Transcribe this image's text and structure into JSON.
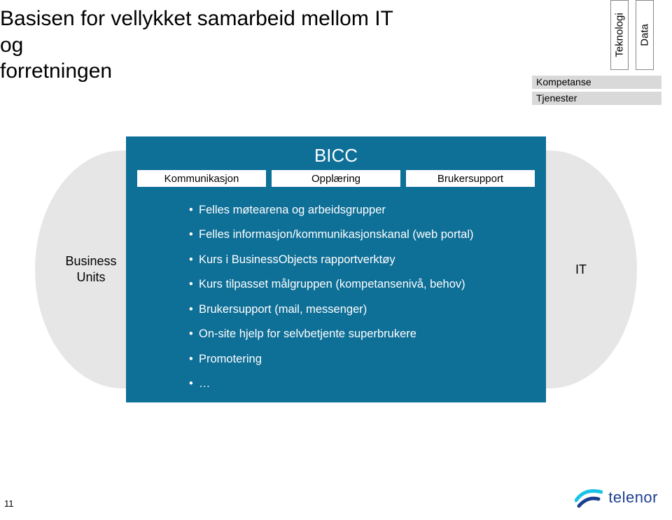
{
  "title_line1": "Basisen for vellykket samarbeid mellom IT og",
  "title_line2": "forretningen",
  "top_right": {
    "vertical": [
      "Teknologi",
      "Data"
    ],
    "horizontal": [
      "Kompetanse",
      "Tjenester"
    ]
  },
  "left_ellipse": "Business\nUnits",
  "right_ellipse": "IT",
  "bicc": {
    "title": "BICC",
    "row": [
      "Kommunikasjon",
      "Opplæring",
      "Brukersupport"
    ],
    "bullets": [
      "Felles møtearena og arbeidsgrupper",
      "Felles informasjon/kommunikasjonskanal (web portal)",
      "Kurs i BusinessObjects rapportverktøy",
      "Kurs tilpasset målgruppen (kompetansenivå, behov)",
      "Brukersupport (mail, messenger)",
      "On-site hjelp for selvbetjente superbrukere",
      "Promotering",
      "…"
    ]
  },
  "page_number": "11",
  "logo_text": "telenor",
  "colors": {
    "center_block": "#0e6f97",
    "ellipse_gray": "#e6e6e6",
    "hbar_gray": "#d9d9d9",
    "logo_blue": "#1b3f8f"
  }
}
